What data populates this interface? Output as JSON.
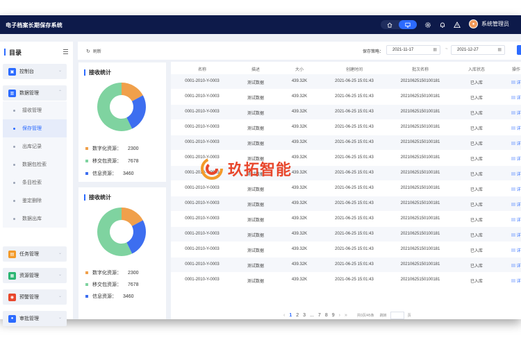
{
  "app": {
    "title": "电子档案长期保存系统",
    "user_name": "系统管理员"
  },
  "top_icons": [
    "home-icon",
    "monitor-icon",
    "gear-icon",
    "bell-icon",
    "warning-icon"
  ],
  "sidebar": {
    "title": "目录",
    "groups_top": [
      {
        "label": "控制台",
        "icon": "dashboard-icon",
        "color": "#2c6bff"
      },
      {
        "label": "数据管理",
        "icon": "chart-icon",
        "color": "#2c6bff"
      }
    ],
    "sub_items": [
      {
        "label": "接收管理"
      },
      {
        "label": "保存管理",
        "active": true
      },
      {
        "label": "出库记录"
      },
      {
        "label": "数据包检索"
      },
      {
        "label": "条目检索"
      },
      {
        "label": "鉴定删除"
      },
      {
        "label": "数据出库"
      }
    ],
    "groups_bottom": [
      {
        "label": "任务管理",
        "icon": "task-icon",
        "color": "#f39a2a"
      },
      {
        "label": "资源管理",
        "icon": "resource-icon",
        "color": "#2bb673"
      },
      {
        "label": "预警管理",
        "icon": "alert-icon",
        "color": "#e8472c"
      },
      {
        "label": "审批管理",
        "icon": "user-icon",
        "color": "#2c6bff"
      }
    ]
  },
  "toolbar": {
    "refresh_label": "刷新",
    "policy_label": "保存策略：",
    "date_start": "2021-11-17",
    "date_end": "2021-12-27",
    "date_sep": "~"
  },
  "stats_cards": [
    {
      "title": "接收统计",
      "slices": [
        {
          "label": "数字化资源：",
          "value": 2300,
          "color": "#f0a04b"
        },
        {
          "label": "移交包资源：",
          "value": 7678,
          "color": "#7fd3a0"
        },
        {
          "label": "信息资源：",
          "value": 3460,
          "color": "#3d6ef0"
        }
      ]
    },
    {
      "title": "接收统计",
      "slices": [
        {
          "label": "数字化资源：",
          "value": 2300,
          "color": "#f0a04b"
        },
        {
          "label": "移交包资源：",
          "value": 7678,
          "color": "#7fd3a0"
        },
        {
          "label": "信息资源：",
          "value": 3460,
          "color": "#3d6ef0"
        }
      ]
    }
  ],
  "table": {
    "columns": [
      "名称",
      "描述",
      "大小",
      "创建时间",
      "批次名称",
      "入库状态",
      "操作"
    ],
    "rows": [
      [
        "0001-2010-Y-0003",
        "测试数据",
        "439.32K",
        "2021-06-25 15:01:43",
        "20210625150100181",
        "已入库",
        "详"
      ],
      [
        "0001-2010-Y-0003",
        "测试数据",
        "439.32K",
        "2021-06-25 15:01:43",
        "20210625150100181",
        "已入库",
        "详"
      ],
      [
        "0001-2010-Y-0003",
        "测试数据",
        "439.32K",
        "2021-06-25 15:01:43",
        "20210625150100181",
        "已入库",
        "详"
      ],
      [
        "0001-2010-Y-0003",
        "测试数据",
        "439.32K",
        "2021-06-25 15:01:43",
        "20210625150100181",
        "已入库",
        "详"
      ],
      [
        "0001-2010-Y-0003",
        "测试数据",
        "439.32K",
        "2021-06-25 15:01:43",
        "20210625150100181",
        "已入库",
        "详"
      ],
      [
        "0001-2010-Y-0003",
        "测试数据",
        "439.32K",
        "2021-06-25 15:01:43",
        "20210625150100181",
        "已入库",
        "详"
      ],
      [
        "0001-2010-Y-0003",
        "测试数据",
        "439.32K",
        "2021-06-25 15:01:43",
        "20210625150100181",
        "已入库",
        "详"
      ],
      [
        "0001-2010-Y-0003",
        "测试数据",
        "439.32K",
        "2021-06-25 15:01:43",
        "20210625150100181",
        "已入库",
        "详"
      ],
      [
        "0001-2010-Y-0003",
        "测试数据",
        "439.32K",
        "2021-06-25 15:01:43",
        "20210625150100181",
        "已入库",
        "详"
      ],
      [
        "0001-2010-Y-0003",
        "测试数据",
        "439.32K",
        "2021-06-25 15:01:43",
        "20210625150100181",
        "已入库",
        "详"
      ],
      [
        "0001-2010-Y-0003",
        "测试数据",
        "439.32K",
        "2021-06-25 15:01:43",
        "20210625150100181",
        "已入库",
        "详"
      ],
      [
        "0001-2010-Y-0003",
        "测试数据",
        "439.32K",
        "2021-06-25 15:01:43",
        "20210625150100181",
        "已入库",
        "详"
      ],
      [
        "0001-2010-Y-0003",
        "测试数据",
        "439.32K",
        "2021-06-25 15:01:43",
        "20210625150100181",
        "已入库",
        "详"
      ],
      [
        "0001-2010-Y-0003",
        "测试数据",
        "439.32K",
        "2021-06-25 15:01:43",
        "20210625150100181",
        "已入库",
        "详"
      ]
    ]
  },
  "pagination": {
    "prev": "‹",
    "pages": [
      "1",
      "2",
      "3",
      "...",
      "7",
      "8",
      "9"
    ],
    "current": "1",
    "next": "›",
    "last": "»",
    "info": "共0页/45条",
    "goto_label": "跳转",
    "page_unit": "页"
  },
  "watermark": {
    "text": "玖拓智能"
  },
  "colors": {
    "topbar": "#0d1a4a",
    "accent": "#2c6bff"
  }
}
